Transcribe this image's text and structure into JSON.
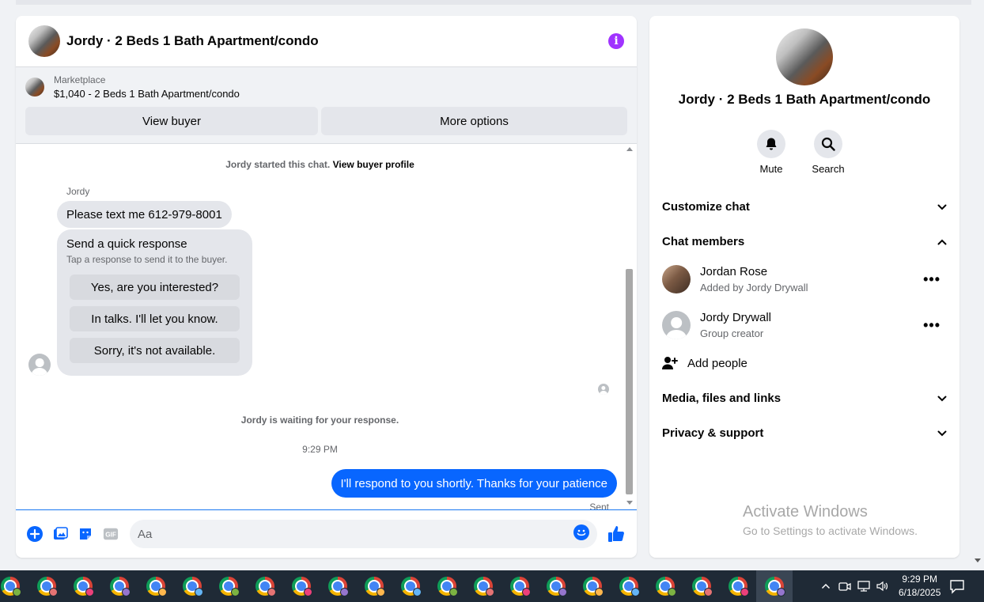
{
  "chat": {
    "title": "Jordy · 2 Beds 1 Bath Apartment/condo",
    "marketplace": {
      "label": "Marketplace",
      "listing": "$1,040 - 2 Beds 1 Bath Apartment/condo",
      "view_buyer": "View buyer",
      "more_options": "More options"
    },
    "started_text": "Jordy started this chat.",
    "view_profile": "View buyer profile",
    "sender": "Jordy",
    "incoming_message": "Please text me 612-979-8001",
    "quick_response": {
      "title": "Send a quick response",
      "subtitle": "Tap a response to send it to the buyer.",
      "options": [
        "Yes, are you interested?",
        "In talks. I'll let you know.",
        "Sorry, it's not available."
      ]
    },
    "waiting_text": "Jordy is waiting for your response.",
    "time": "9:29 PM",
    "outgoing_message": "I'll respond to you shortly. Thanks for your patience",
    "sent_label": "Sent",
    "composer_placeholder": "Aa"
  },
  "sidebar": {
    "title": "Jordy · 2 Beds 1 Bath Apartment/condo",
    "actions": [
      {
        "label": "Mute",
        "icon": "bell-icon"
      },
      {
        "label": "Search",
        "icon": "search-icon"
      }
    ],
    "customize_chat": "Customize chat",
    "chat_members": "Chat members",
    "members": [
      {
        "name": "Jordan Rose",
        "sub": "Added by Jordy Drywall"
      },
      {
        "name": "Jordy Drywall",
        "sub": "Group creator"
      }
    ],
    "add_people": "Add people",
    "media_files": "Media, files and links",
    "privacy_support": "Privacy & support"
  },
  "watermark": {
    "title": "Activate Windows",
    "subtitle": "Go to Settings to activate Windows."
  },
  "taskbar": {
    "time": "9:29 PM",
    "date": "6/18/2025",
    "app_count": 22
  },
  "colors": {
    "accent": "#0866ff",
    "info": "#a033ff",
    "taskbar": "#1f2a36"
  }
}
